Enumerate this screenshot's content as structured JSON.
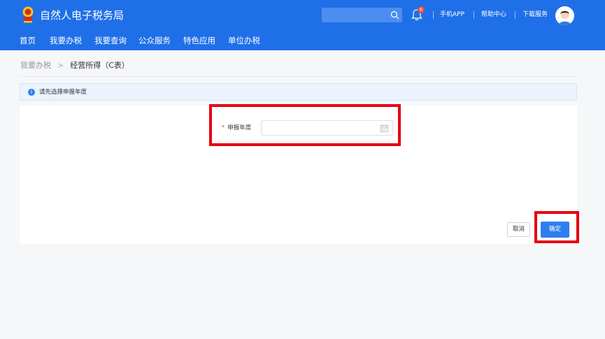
{
  "header": {
    "site_title": "自然人电子税务局",
    "search_placeholder": "",
    "notification_count": "6",
    "links": [
      "手机APP",
      "帮助中心",
      "下载服务"
    ]
  },
  "nav": {
    "items": [
      "首页",
      "我要办税",
      "我要查询",
      "公众服务",
      "特色应用",
      "单位办税"
    ]
  },
  "breadcrumb": {
    "parent": "我要办税",
    "current": "经营所得（C表）"
  },
  "notice": {
    "text": "请先选择申报年度"
  },
  "form": {
    "required_mark": "*",
    "year_label": "申报年度",
    "year_value": "",
    "year_placeholder": ""
  },
  "actions": {
    "cancel_label": "取消",
    "confirm_label": "确定"
  },
  "colors": {
    "header_bg": "#1f6fe8",
    "primary": "#2f7ef0",
    "highlight": "#e60012",
    "required": "#f04a3c"
  }
}
